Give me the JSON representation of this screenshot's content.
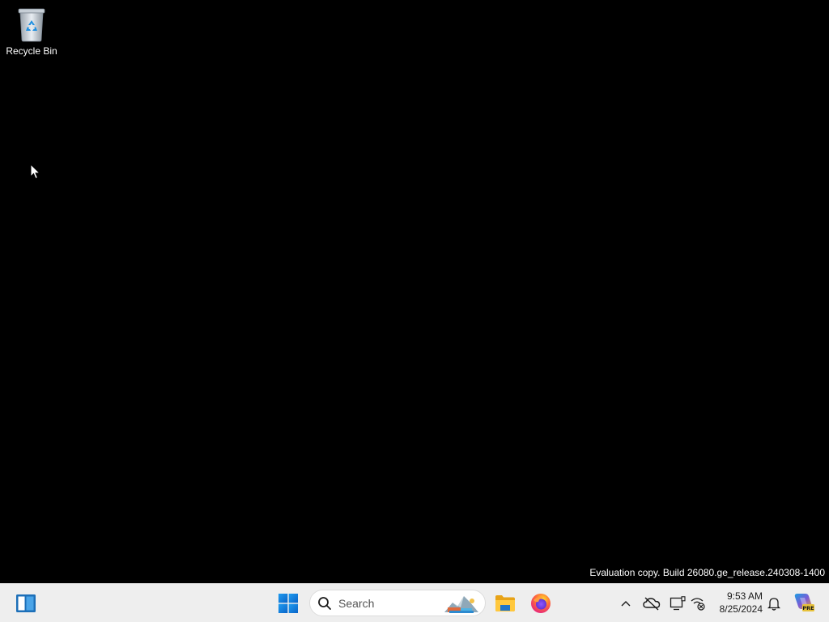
{
  "desktop": {
    "background": "#000000",
    "icons": [
      {
        "label": "Recycle Bin",
        "icon": "recycle-bin-icon"
      }
    ],
    "watermark": "Evaluation copy. Build 26080.ge_release.240308-1400"
  },
  "taskbar": {
    "background": "#eeeeee",
    "widgets_icon": "widgets-icon",
    "start_icon": "windows-start-icon",
    "search": {
      "placeholder": "Search",
      "icon": "search-icon"
    },
    "pinned_apps": [
      {
        "name": "File Explorer",
        "icon": "folder-icon"
      },
      {
        "name": "Firefox",
        "icon": "firefox-icon"
      }
    ],
    "tray": {
      "icons": [
        "chevron-up-icon",
        "onedrive-cloud-icon",
        "display-icon",
        "network-icon"
      ],
      "time": "9:53 AM",
      "date": "8/25/2024",
      "notification_icon": "bell-icon",
      "copilot_icon": "copilot-icon",
      "copilot_badge": "PRE"
    }
  }
}
